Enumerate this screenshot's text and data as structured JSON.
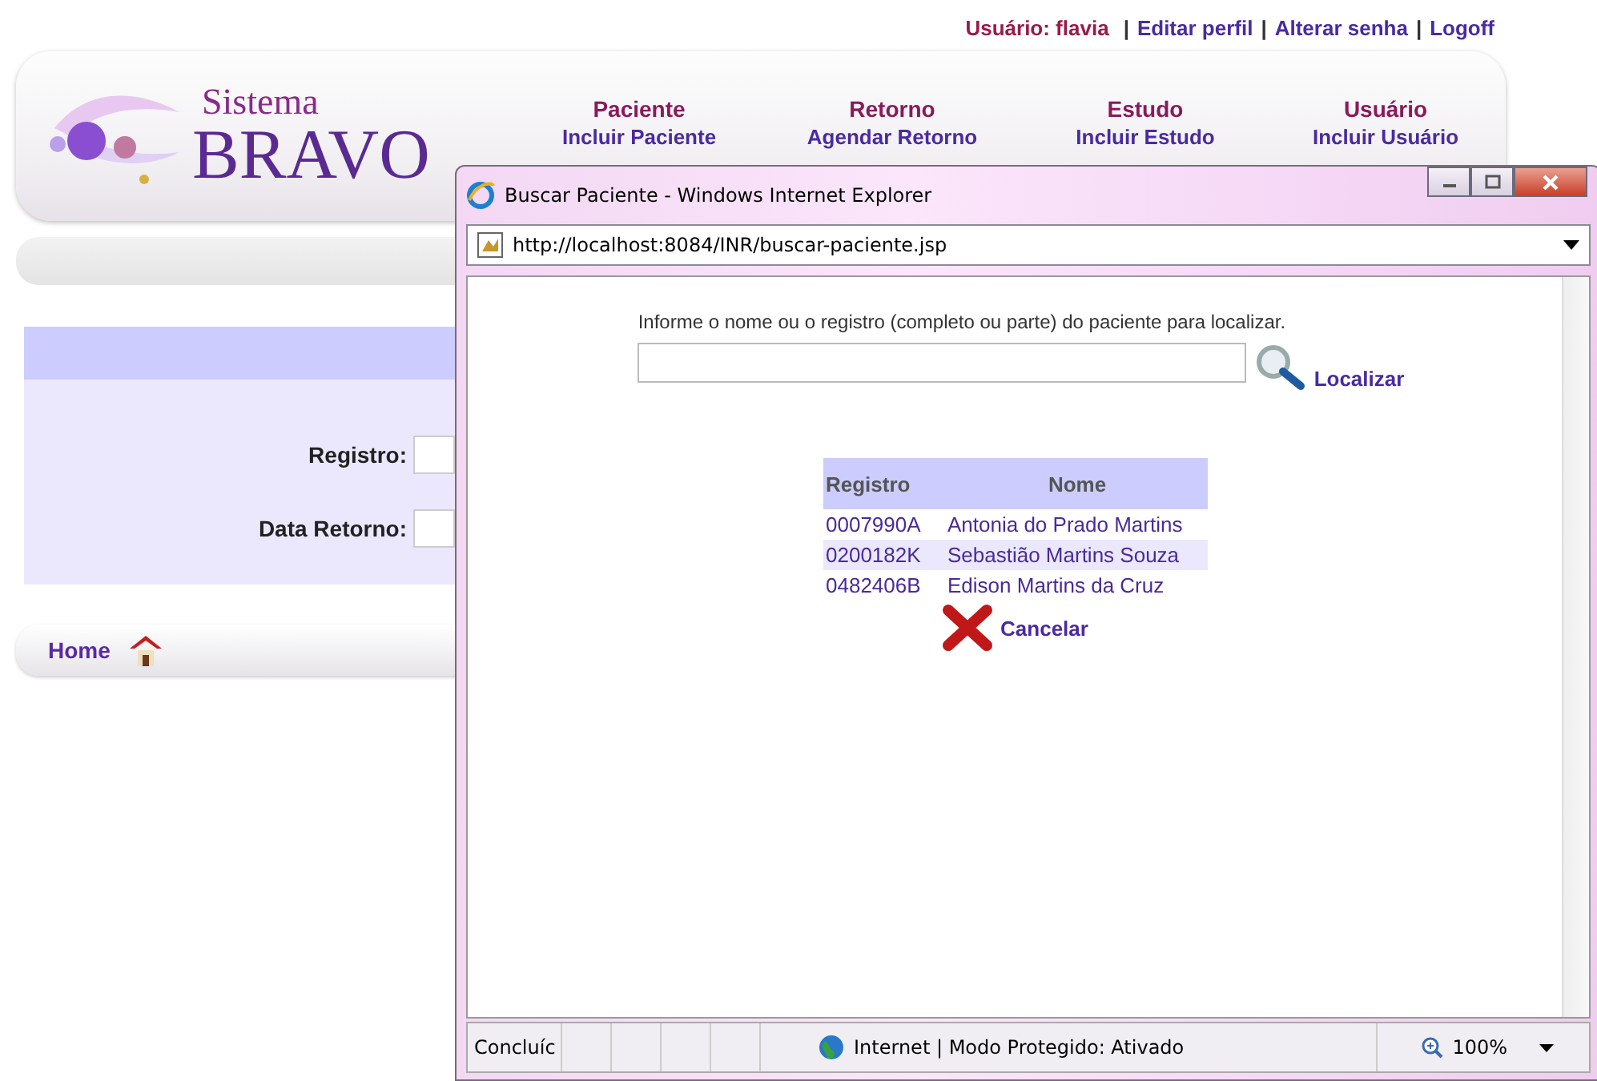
{
  "user_bar": {
    "user_label": "Usuário: flavia",
    "links": [
      {
        "separator": "|",
        "label": "Editar perfil"
      },
      {
        "separator": "|",
        "label": "Alterar senha"
      },
      {
        "separator": "|",
        "label": "Logoff"
      }
    ]
  },
  "logo": {
    "line1": "Sistema",
    "line2": "BRAVO"
  },
  "menu": [
    {
      "title": "Paciente",
      "items": [
        "Incluir Paciente"
      ]
    },
    {
      "title": "Retorno",
      "items": [
        "Agendar Retorno"
      ]
    },
    {
      "title": "Estudo",
      "items": [
        "Incluir Estudo"
      ]
    },
    {
      "title": "Usuário",
      "items": [
        "Incluir Usuário"
      ]
    }
  ],
  "form": {
    "fields": [
      {
        "label": "Registro:"
      },
      {
        "label": "Data Retorno:"
      }
    ]
  },
  "footer": {
    "home_link": "Home"
  },
  "popup": {
    "title": "Buscar Paciente - Windows Internet Explorer",
    "address": "http://localhost:8084/INR/buscar-paciente.jsp",
    "instruction": "Informe o nome ou o registro (completo ou parte) do paciente para localizar.",
    "search_button": "Localizar",
    "table": {
      "columns": [
        "Registro",
        "Nome"
      ],
      "rows": [
        {
          "registro": "0007990A",
          "nome": "Antonia do Prado Martins",
          "selected": false
        },
        {
          "registro": "0200182K",
          "nome": "Sebastião Martins Souza",
          "selected": true
        },
        {
          "registro": "0482406B",
          "nome": "Edison Martins da Cruz",
          "selected": false
        }
      ]
    },
    "cancel": "Cancelar",
    "status": {
      "text": "Concluíc",
      "zone": "Internet | Modo Protegido: Ativado",
      "zoom": "100%"
    }
  }
}
